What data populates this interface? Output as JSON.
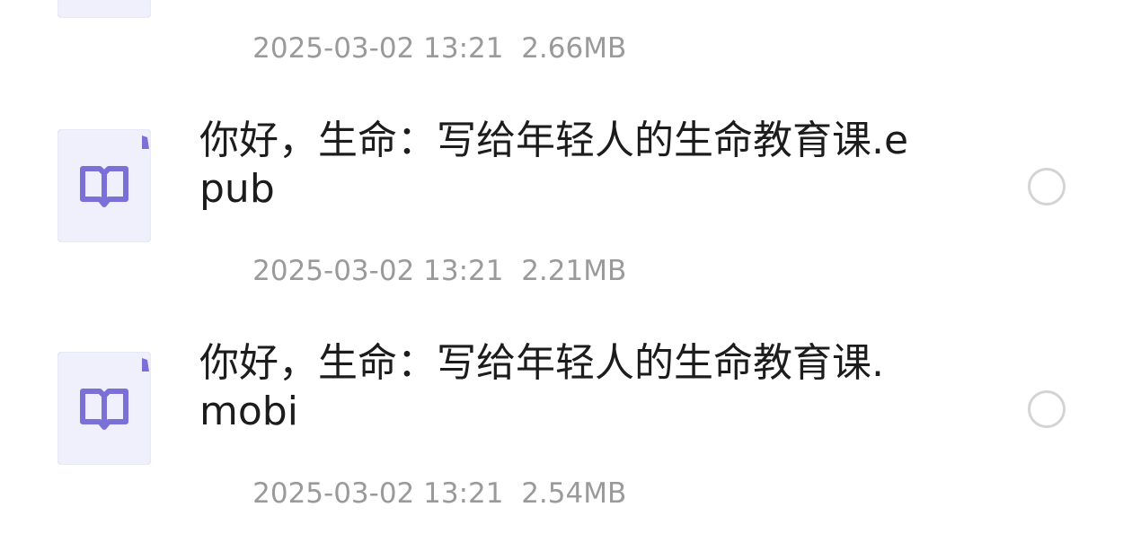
{
  "files": [
    {
      "name": "",
      "date": "2025-03-02 13:21",
      "size": "2.66MB",
      "icon": "book-icon"
    },
    {
      "name": "你好，生命：写给年轻人的生命教育课.epub",
      "date": "2025-03-02 13:21",
      "size": "2.21MB",
      "icon": "book-icon"
    },
    {
      "name": "你好，生命：写给年轻人的生命教育课.mobi",
      "date": "2025-03-02 13:21",
      "size": "2.54MB",
      "icon": "book-icon"
    }
  ],
  "colors": {
    "icon_bg": "#f0f0fc",
    "icon_accent": "#7b70d8",
    "name_text": "#1c1c1c",
    "meta_text": "#9a9a9a",
    "radio_border": "#d4d4d4"
  }
}
